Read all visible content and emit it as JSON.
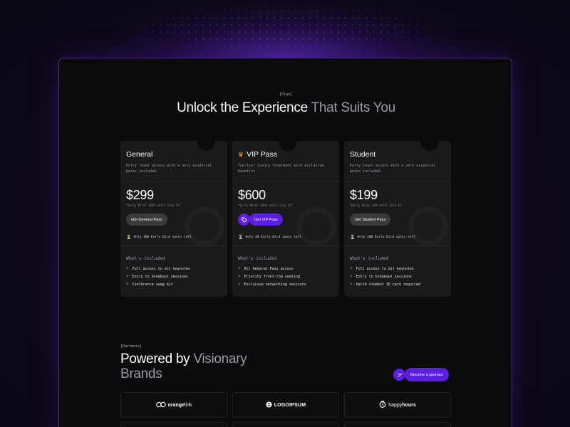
{
  "pricing": {
    "tag": "[Plan]",
    "title_main": "Unlock the Experience",
    "title_dim": "That Suits You",
    "whats_included_label": "What's included",
    "plans": [
      {
        "name": "General",
        "description": "Entry level access with a very essential perks included.",
        "price": "$299",
        "early_bird": "*Early Bird: $249 until July 15\"",
        "button": "Get General Pass",
        "spots": "Only 100 Early Bird spots left",
        "features": [
          "Full access to all keynotes",
          "Entry to breakout sessions",
          "Conference swag kit"
        ]
      },
      {
        "name": "VIP Pass",
        "description": "Top-tier luxury treatment with exclusive benefits.",
        "price": "$600",
        "early_bird": "*Early Bird: $599 until July 15\"",
        "button": "Get VIP Pass",
        "spots": "Only 30 Early Bird spots left",
        "features": [
          "All General Pass access",
          "Priority front-row seating",
          "Exclusive networking sessions"
        ]
      },
      {
        "name": "Student",
        "description": "Entry level access with a very essential perks included.",
        "price": "$199",
        "early_bird": "*Early Bird: $49 until July 15\"",
        "button": "Get Student Pass",
        "spots": "Only 100 Early Bird spots left",
        "features": [
          "Full access to all keynotes",
          "Entry to breakout sessions",
          "Valid student ID card required"
        ]
      }
    ]
  },
  "partners": {
    "tag": "[Partners]",
    "title_main": "Powered by",
    "title_dim_1": "Visionary",
    "title_dim_2": "Brands",
    "sponsor_button": "Become a sponsor",
    "logos": [
      {
        "name": "orangelink",
        "prefix": "orange",
        "suffix": "link"
      },
      {
        "name": "LOGOIPSUM"
      },
      {
        "name": "happyhours",
        "prefix": "happy",
        "suffix": "hours"
      }
    ]
  },
  "colors": {
    "accent": "#5b1fe0",
    "frame_border": "#4a2a8a",
    "card_bg": "#1a1a1c",
    "page_bg": "#0a0612"
  },
  "icons": {
    "vip_crown": "crown-icon",
    "vip_button": "tag-icon",
    "spots": "hourglass-icon",
    "feature": "plus-icon",
    "sponsor": "handshake-icon"
  }
}
